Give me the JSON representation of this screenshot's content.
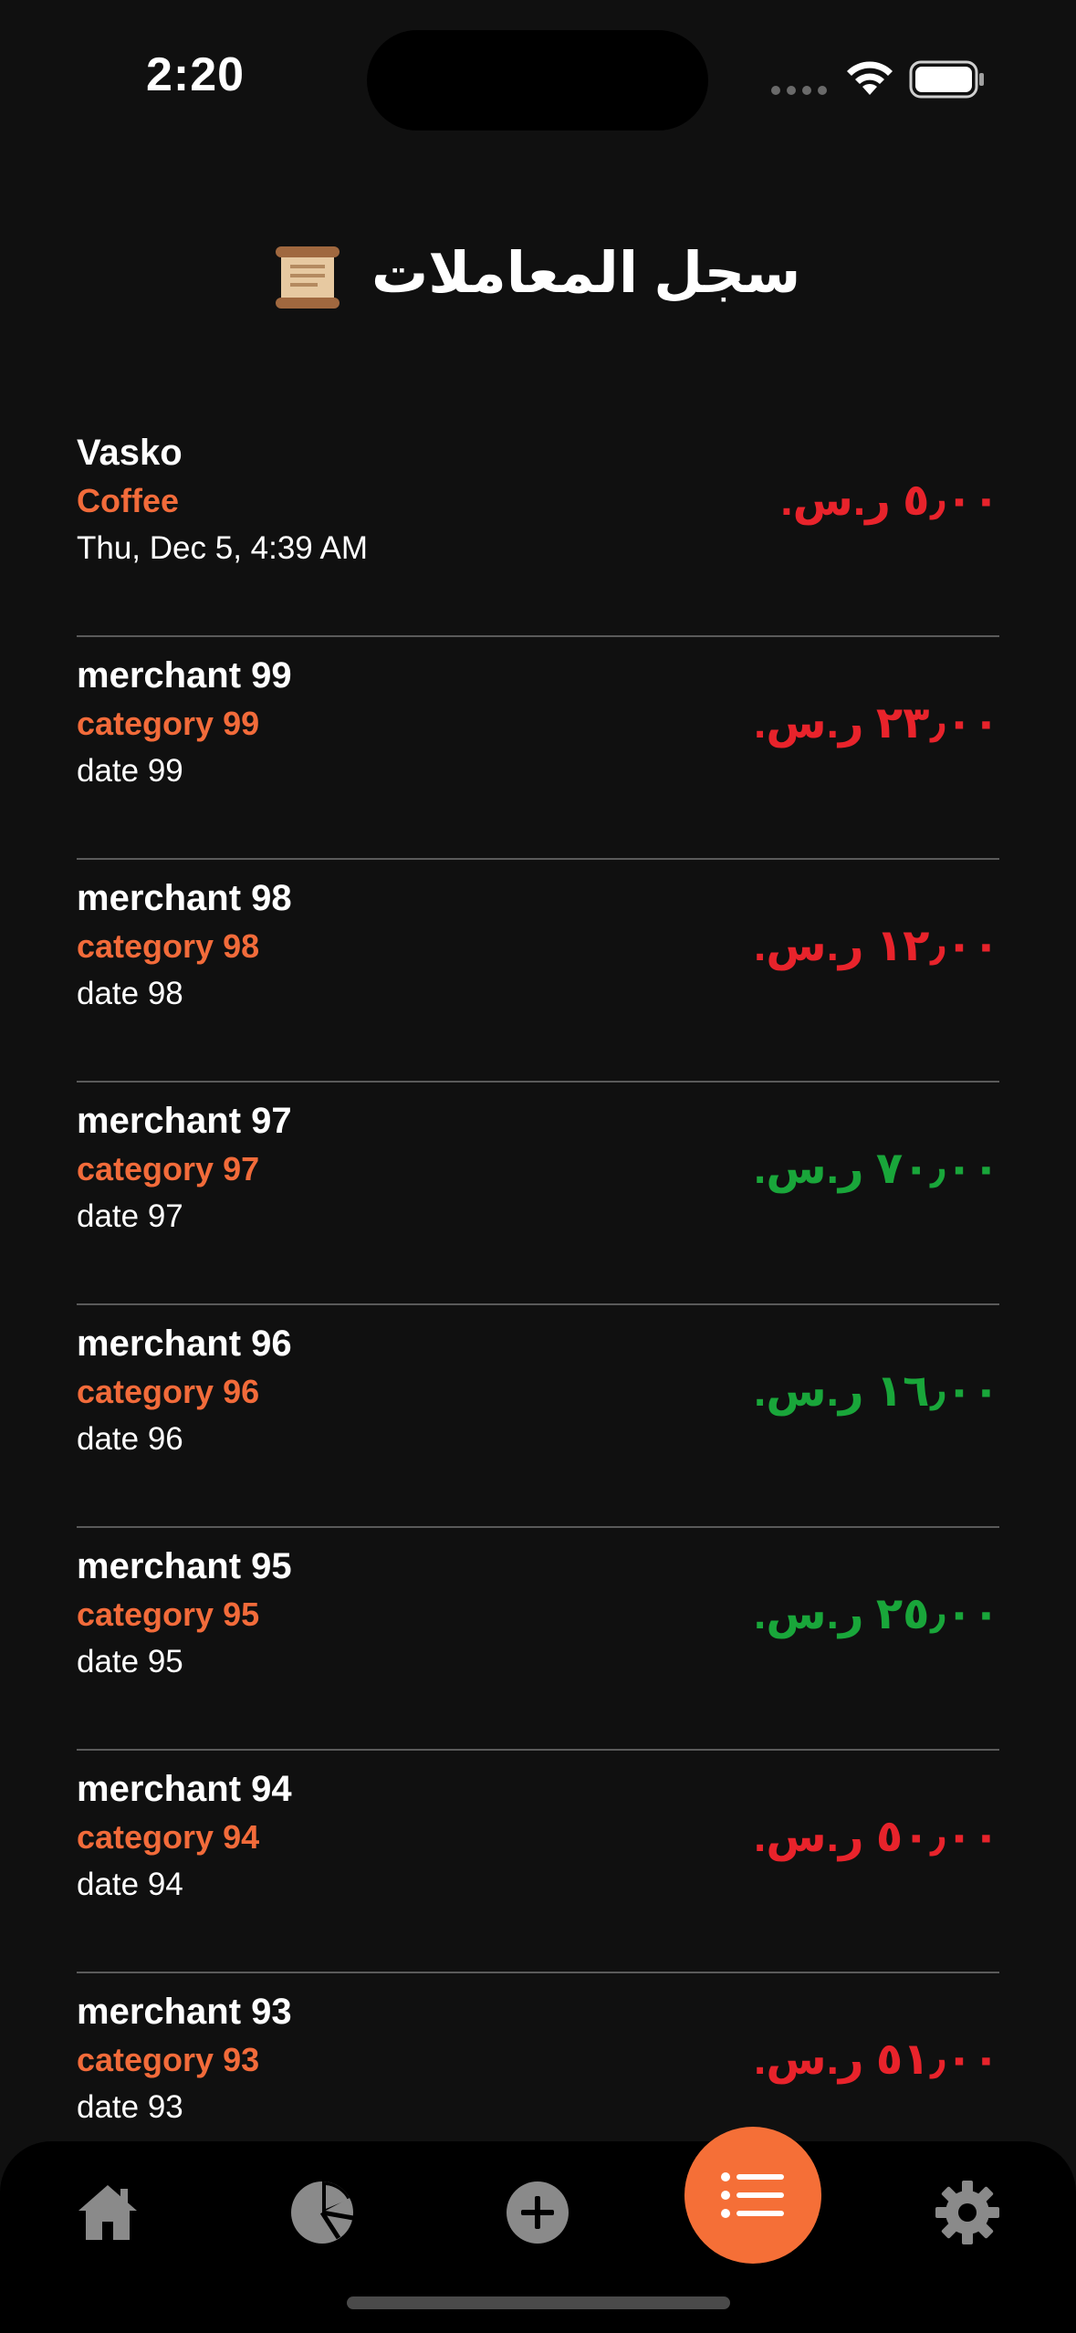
{
  "status_bar": {
    "time": "2:20"
  },
  "header": {
    "title": "سجل المعاملات"
  },
  "transactions": [
    {
      "merchant": "Vasko",
      "category": "Coffee",
      "date": "Thu, Dec 5, 4:39 AM",
      "amount": "٥٫٠٠ ر.س.",
      "type": "expense"
    },
    {
      "merchant": "merchant 99",
      "category": "category 99",
      "date": "date 99",
      "amount": "٢٣٫٠٠ ر.س.",
      "type": "expense"
    },
    {
      "merchant": "merchant 98",
      "category": "category 98",
      "date": "date 98",
      "amount": "١٢٫٠٠ ر.س.",
      "type": "expense"
    },
    {
      "merchant": "merchant 97",
      "category": "category 97",
      "date": "date 97",
      "amount": "٧٠٫٠٠ ر.س.",
      "type": "income"
    },
    {
      "merchant": "merchant 96",
      "category": "category 96",
      "date": "date 96",
      "amount": "١٦٫٠٠ ر.س.",
      "type": "income"
    },
    {
      "merchant": "merchant 95",
      "category": "category 95",
      "date": "date 95",
      "amount": "٢٥٫٠٠ ر.س.",
      "type": "income"
    },
    {
      "merchant": "merchant 94",
      "category": "category 94",
      "date": "date 94",
      "amount": "٥٠٫٠٠ ر.س.",
      "type": "expense"
    },
    {
      "merchant": "merchant 93",
      "category": "category 93",
      "date": "date 93",
      "amount": "٥١٫٠٠ ر.س.",
      "type": "expense"
    }
  ],
  "tab_bar": {
    "items": [
      {
        "icon": "home-icon"
      },
      {
        "icon": "pie-chart-icon"
      },
      {
        "icon": "add-circle-icon"
      },
      {
        "icon": "list-icon",
        "active": true
      },
      {
        "icon": "gear-icon"
      }
    ]
  },
  "colors": {
    "accent": "#f56f37",
    "expense": "#e8232b",
    "income": "#19a63a",
    "background": "#101010"
  }
}
